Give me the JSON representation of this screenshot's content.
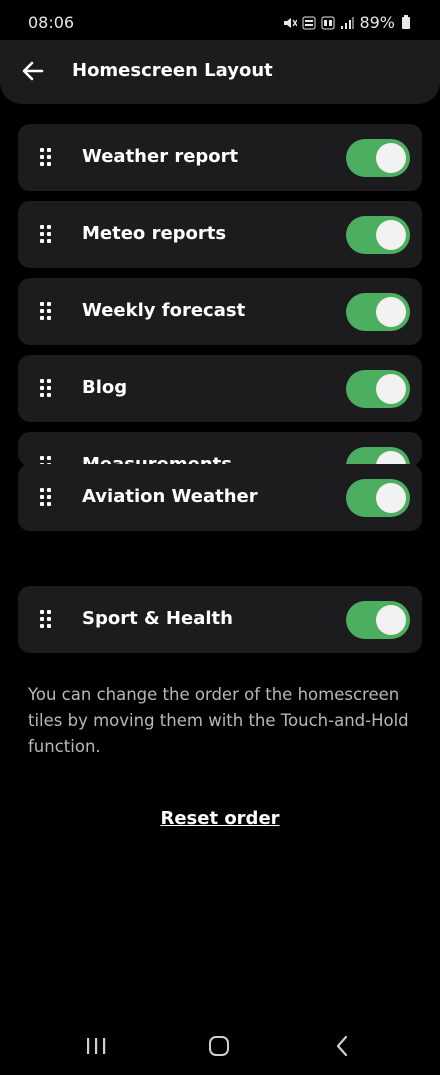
{
  "status_bar": {
    "time": "08:06",
    "battery": "89%"
  },
  "header": {
    "title": "Homescreen Layout",
    "back_icon": "arrow-left-icon"
  },
  "tiles": [
    {
      "label": "Weather report",
      "enabled": true
    },
    {
      "label": "Meteo reports",
      "enabled": true
    },
    {
      "label": "Weekly forecast",
      "enabled": true
    },
    {
      "label": "Blog",
      "enabled": true
    },
    {
      "label": "Measurements",
      "enabled": true
    },
    {
      "label": "Aviation Weather",
      "enabled": true
    },
    {
      "label": "Sport & Health",
      "enabled": true
    }
  ],
  "hint_text": "You can change the order of the homescreen tiles by moving them with the Touch-and-Hold function.",
  "reset_label": "Reset order",
  "colors": {
    "toggle_on": "#4caf5f",
    "card_bg": "#1c1c1e",
    "background": "#000000"
  }
}
